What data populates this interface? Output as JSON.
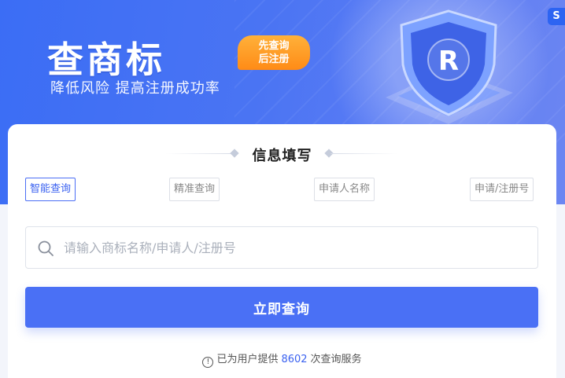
{
  "hero": {
    "title": "查商标",
    "badge_line1": "先查询",
    "badge_line2": "后注册",
    "subtitle": "降低风险 提高注册成功率",
    "shield_letter": "R",
    "logo_letter": "S"
  },
  "form": {
    "title": "信息填写",
    "tabs": [
      {
        "label": "智能查询",
        "active": true
      },
      {
        "label": "精准查询",
        "active": false
      },
      {
        "label": "申请人名称",
        "active": false
      },
      {
        "label": "申请/注册号",
        "active": false
      }
    ],
    "search": {
      "placeholder": "请输入商标名称/申请人/注册号",
      "value": ""
    },
    "submit_label": "立即查询"
  },
  "footer": {
    "prefix": "已为用户提供",
    "count": "8602",
    "suffix": "次查询服务",
    "icon": "info-icon"
  },
  "colors": {
    "primary": "#4a70f5",
    "badge": "#ff8b16"
  }
}
